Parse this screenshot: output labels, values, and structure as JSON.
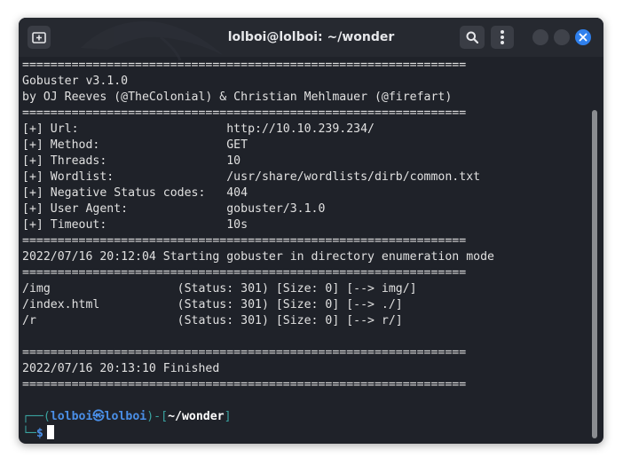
{
  "window": {
    "title": "lolboi@lolboi: ~/wonder"
  },
  "colors": {
    "window_bg": "#1f2229",
    "titlebar_bg": "#262930",
    "close_button": "#2f80ed",
    "prompt_teal": "#3aa3a0",
    "prompt_blue": "#4a8fe7",
    "text": "#e0e0e0"
  },
  "icons": {
    "new_tab": "new-tab-icon",
    "search": "search-icon",
    "menu": "kebab-menu-icon",
    "minimize": "minimize-icon",
    "maximize": "maximize-icon",
    "close": "close-icon",
    "logo": "kali-dragon-icon"
  },
  "terminal": {
    "lines": [
      "===============================================================",
      "Gobuster v3.1.0",
      "by OJ Reeves (@TheColonial) & Christian Mehlmauer (@firefart)",
      "===============================================================",
      "[+] Url:                     http://10.10.239.234/",
      "[+] Method:                  GET",
      "[+] Threads:                 10",
      "[+] Wordlist:                /usr/share/wordlists/dirb/common.txt",
      "[+] Negative Status codes:   404",
      "[+] User Agent:              gobuster/3.1.0",
      "[+] Timeout:                 10s",
      "===============================================================",
      "2022/07/16 20:12:04 Starting gobuster in directory enumeration mode",
      "===============================================================",
      "/img                  (Status: 301) [Size: 0] [--> img/]",
      "/index.html           (Status: 301) [Size: 0] [--> ./]",
      "/r                    (Status: 301) [Size: 0] [--> r/]",
      "",
      "===============================================================",
      "2022/07/16 20:13:10 Finished",
      "===============================================================",
      ""
    ],
    "prompt": {
      "open": "┌──(",
      "user": "lolboi",
      "at": "㉿",
      "host": "lolboi",
      "mid": ")-[",
      "path": "~/wonder",
      "close": "]",
      "line2_prefix": "└─",
      "symbol": "$"
    }
  }
}
